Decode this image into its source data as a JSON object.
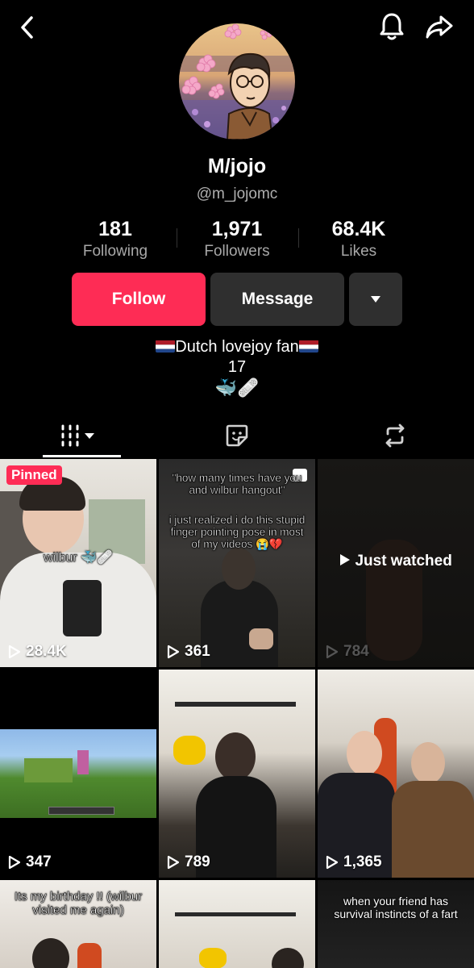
{
  "profile": {
    "name": "M/jojo",
    "handle": "@m_jojomc",
    "stats": [
      {
        "value": "181",
        "label": "Following"
      },
      {
        "value": "1,971",
        "label": "Followers"
      },
      {
        "value": "68.4K",
        "label": "Likes"
      }
    ],
    "bio_line1": "Dutch lovejoy fan",
    "bio_line2": "17",
    "bio_line3": "🐳🩹"
  },
  "actions": {
    "follow": "Follow",
    "message": "Message"
  },
  "icons": {
    "back": "chevron-left-icon",
    "notifications": "bell-icon",
    "share": "share-arrow-icon",
    "videos_tab": "grid-icon",
    "liked_tab": "sticker-icon",
    "reposts_tab": "repost-icon"
  },
  "colors": {
    "accent": "#fe2c55",
    "secondary_button": "#2f2f2f",
    "background": "#000000"
  },
  "videos": [
    {
      "count": "28.4K",
      "badge": "Pinned",
      "caption": "wilbur 🐳🩹"
    },
    {
      "count": "361",
      "caption_top": "\"how many times have you and wilbur hangout\"",
      "caption_mid": "i just realized i do this stupid finger pointing pose in most of my videos 😭💔"
    },
    {
      "count": "784",
      "overlay": "Just watched"
    },
    {
      "count": "347"
    },
    {
      "count": "789"
    },
    {
      "count": "1,365"
    },
    {
      "caption": "Its my birthday !! (wilbur visited me again)"
    },
    {},
    {
      "caption": "when your friend has survival instincts of a fart"
    }
  ]
}
